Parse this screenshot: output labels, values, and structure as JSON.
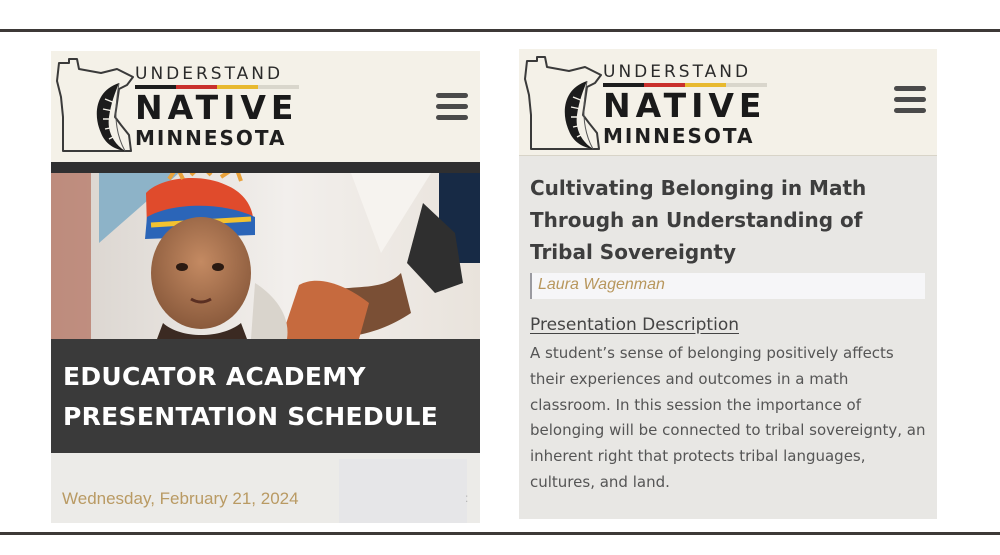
{
  "brand": {
    "line1": "UNDERSTAND",
    "line2": "NATIVE",
    "line3": "MINNESOTA",
    "stripe_colors": [
      "#1d1d1d",
      "#c9302c",
      "#e8b92f",
      "#f4f1e8"
    ]
  },
  "icons": {
    "menu": "hamburger-menu-icon",
    "logo": "minnesota-state-outline-feather-logo"
  },
  "left_panel": {
    "title": "EDUCATOR ACADEMY PRESENTATION SCHEDULE",
    "date": "Wednesday, February 21, 2024",
    "edge_marker": ":",
    "hero_image": "child-in-beaded-headdress-regalia-photo"
  },
  "right_panel": {
    "title": "Cultivating Belonging in Math Through an Understanding of Tribal Sovereignty",
    "author": "Laura Wagenman",
    "description_heading": "Presentation Description",
    "description": "A student’s sense of belonging positively affects their experiences and outcomes in a math classroom. In this session the importance of belonging will be connected to tribal sovereignty, an inherent right that protects tribal languages, cultures, and land."
  },
  "colors": {
    "accent_gold": "#b99a63",
    "title_band": "#3a3a3a",
    "header_bg": "#f4f1e8"
  }
}
